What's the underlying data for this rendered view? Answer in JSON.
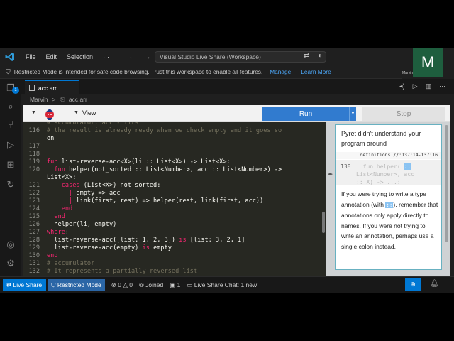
{
  "titlebar": {
    "menu": [
      "File",
      "Edit",
      "Selection",
      "···"
    ],
    "command_center": "Visual Studio Live Share (Workspace)",
    "avatar_letter": "M",
    "avatar_name": "Marvin"
  },
  "banner": {
    "text": "Restricted Mode is intended for safe code browsing. Trust this workspace to enable all features.",
    "manage": "Manage",
    "learn_more": "Learn More"
  },
  "activitybar": {
    "badge": "1"
  },
  "tab": {
    "label": "acc.arr"
  },
  "breadcrumbs": {
    "folder": "Marvin",
    "separator": ">",
    "file": "acc.arr"
  },
  "pyret": {
    "view": "View",
    "run": "Run",
    "stop": "Stop"
  },
  "code_lines": [
    {
      "n": "",
      "t": "# accumulator: acc - first"
    },
    {
      "n": "116",
      "t": "# the result is already ready when we check empty and it goes so"
    },
    {
      "n": "",
      "t": "on"
    },
    {
      "n": "117",
      "t": ""
    },
    {
      "n": "118",
      "t": ""
    },
    {
      "n": "119",
      "t": "fun list-reverse-acc<X>(li :: List<X>) -> List<X>:"
    },
    {
      "n": "120",
      "t": "  fun helper(not_sorted :: List<Number>, acc :: List<Number>) ->"
    },
    {
      "n": "",
      "t": "List<X>:"
    },
    {
      "n": "121",
      "t": "    cases (List<X>) not_sorted:"
    },
    {
      "n": "122",
      "t": "      | empty => acc"
    },
    {
      "n": "123",
      "t": "      | link(first, rest) => helper(rest, link(first, acc))"
    },
    {
      "n": "124",
      "t": "    end"
    },
    {
      "n": "125",
      "t": "  end"
    },
    {
      "n": "126",
      "t": "  helper(li, empty)"
    },
    {
      "n": "127",
      "t": "where:"
    },
    {
      "n": "128",
      "t": "  list-reverse-acc([list: 1, 2, 3]) is [list: 3, 2, 1]"
    },
    {
      "n": "129",
      "t": "  list-reverse-acc(empty) is empty"
    },
    {
      "n": "130",
      "t": "end"
    },
    {
      "n": "131",
      "t": "# accumulator"
    },
    {
      "n": "132",
      "t": "# It represents a partially reversed list"
    }
  ],
  "error": {
    "heading": "Pyret didn't understand your program around",
    "location": "definitions://:137:14-137:16",
    "snippet_line": "138",
    "snippet_1": "  fun helper(",
    "snippet_1_hl": "::",
    "snippet_2": "List<Number>, acc",
    "snippet_3": ":: X) -> ...:",
    "body_1": "If you were trying to write a type annotation (with ",
    "body_colons": "::",
    "body_2": "), remember that annotations only apply directly to names. If you were not trying to write an annotation, perhaps use a single colon instead."
  },
  "statusbar": {
    "live_share": "Live Share",
    "restricted": "Restricted Mode",
    "problems": "0",
    "warnings": "0",
    "joined": "Joined",
    "participants": "1",
    "chat": "Live Share Chat: 1 new"
  }
}
